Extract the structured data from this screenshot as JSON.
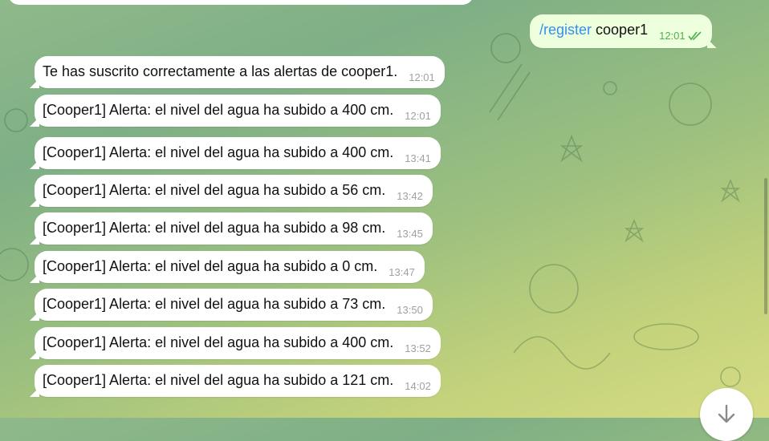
{
  "outgoing": {
    "command": "/register",
    "argument": " cooper1",
    "time": "12:01"
  },
  "messages": [
    {
      "text": "Te has suscrito correctamente a las alertas de cooper1.",
      "time": "12:01"
    },
    {
      "text": "[Cooper1] Alerta: el nivel del agua ha subido a 400 cm.",
      "time": "12:01"
    },
    {
      "text": "[Cooper1] Alerta: el nivel del agua ha subido a 400 cm.",
      "time": "13:41"
    },
    {
      "text": "[Cooper1] Alerta: el nivel del agua ha subido a 56 cm.",
      "time": "13:42"
    },
    {
      "text": "[Cooper1] Alerta: el nivel del agua ha subido a 98 cm.",
      "time": "13:45"
    },
    {
      "text": "[Cooper1] Alerta: el nivel del agua ha subido a 0 cm.",
      "time": "13:47"
    },
    {
      "text": "[Cooper1] Alerta: el nivel del agua ha subido a 73 cm.",
      "time": "13:50"
    },
    {
      "text": "[Cooper1] Alerta: el nivel del agua ha subido a 400 cm.",
      "time": "13:52"
    },
    {
      "text": "[Cooper1] Alerta: el nivel del agua ha subido a 121 cm.",
      "time": "14:02"
    }
  ],
  "icons": {
    "read_status": "double-check-icon",
    "scroll_down": "arrow-down-icon"
  },
  "colors": {
    "command_link": "#3390ec",
    "outgoing_bubble": "#eeffde",
    "incoming_bubble": "#ffffff",
    "read_ticks": "#4fae4e"
  }
}
